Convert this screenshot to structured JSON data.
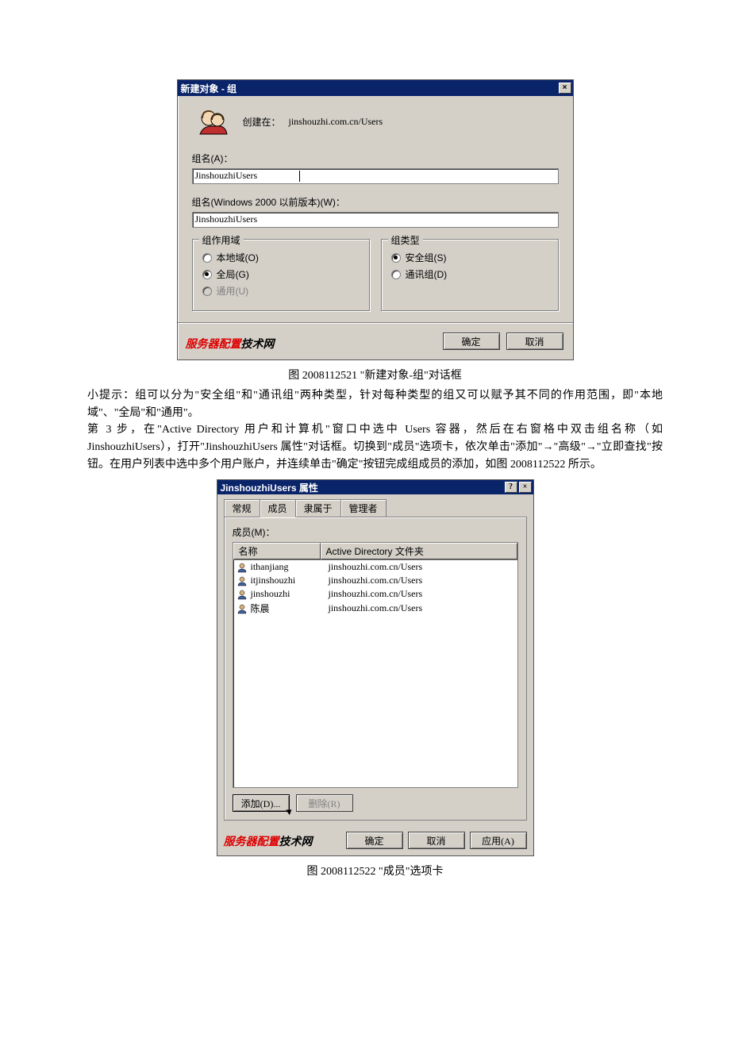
{
  "dialog1": {
    "title": "新建对象 - 组",
    "close_x": "×",
    "create_in_label": "创建在：",
    "create_in_path": "jinshouzhi.com.cn/Users",
    "group_name_label": "组名(A)：",
    "group_name_value": "JinshouzhiUsers",
    "group_name_pre2000_label": "组名(Windows 2000 以前版本)(W)：",
    "group_name_pre2000_value": "JinshouzhiUsers",
    "scope_box_title": "组作用域",
    "scope_options": {
      "local": "本地域(O)",
      "global": "全局(G)",
      "universal": "通用(U)"
    },
    "type_box_title": "组类型",
    "type_options": {
      "security": "安全组(S)",
      "distribution": "通讯组(D)"
    },
    "ok_label": "确定",
    "cancel_label": "取消",
    "watermark_red": "服务器配置",
    "watermark_black": "技术网"
  },
  "caption1": "图 2008112521  \"新建对象-组\"对话框",
  "body_text_1": "小提示：组可以分为\"安全组\"和\"通讯组\"两种类型，针对每种类型的组又可以赋予其不同的作用范围，即\"本地域\"、\"全局\"和\"通用\"。",
  "body_text_2": "第 3 步，在\"Active Directory 用户和计算机\"窗口中选中 Users 容器，然后在右窗格中双击组名称（如 JinshouzhiUsers），打开\"JinshouzhiUsers 属性\"对话框。切换到\"成员\"选项卡，依次单击\"添加\"→\"高级\"→\"立即查找\"按钮。在用户列表中选中多个用户账户，并连续单击\"确定\"按钮完成组成员的添加，如图 2008112522 所示。",
  "dialog2": {
    "title": "JinshouzhiUsers 属性",
    "help_btn": "?",
    "close_btn": "×",
    "tabs": [
      "常规",
      "成员",
      "隶属于",
      "管理者"
    ],
    "active_tab_index": 1,
    "members_label": "成员(M)：",
    "columns": {
      "name": "名称",
      "folder": "Active Directory 文件夹"
    },
    "rows": [
      {
        "name": "ithanjiang",
        "path": "jinshouzhi.com.cn/Users"
      },
      {
        "name": "itjinshouzhi",
        "path": "jinshouzhi.com.cn/Users"
      },
      {
        "name": "jinshouzhi",
        "path": "jinshouzhi.com.cn/Users"
      },
      {
        "name": "陈晨",
        "path": "jinshouzhi.com.cn/Users"
      }
    ],
    "add_label": "添加(D)...",
    "remove_label": "删除(R)",
    "ok_label": "确定",
    "cancel_label": "取消",
    "apply_label": "应用(A)",
    "watermark_red": "服务器配置",
    "watermark_black": "技术网"
  },
  "caption2": "图 2008112522  \"成员\"选项卡"
}
